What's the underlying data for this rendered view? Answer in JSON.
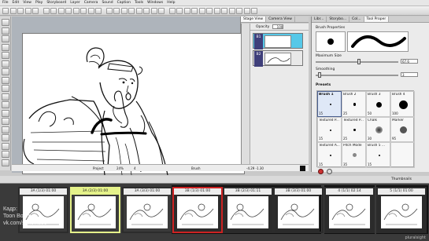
{
  "menu": [
    "File",
    "Edit",
    "View",
    "Play",
    "Storyboard",
    "Layer",
    "Camera",
    "Sound",
    "Caption",
    "Tools",
    "Windows",
    "Help"
  ],
  "stage_tabs": [
    "Stage View",
    "Camera View"
  ],
  "layers": {
    "opacity_label": "Opacity",
    "opacity_value": "100",
    "rows": [
      "B1",
      "B2"
    ]
  },
  "right_tabs": [
    "Libr...",
    "Storybo...",
    "Col...",
    "Tool Proper"
  ],
  "brush": {
    "properties_label": "Brush Properties",
    "max_size_label": "Maximum Size",
    "max_size_value": "67.6",
    "smoothing_label": "Smoothing",
    "smoothing_value": "3",
    "presets_label": "Presets",
    "presets": [
      {
        "name": "Brush 1",
        "value": "15"
      },
      {
        "name": "Brush 2",
        "value": "25"
      },
      {
        "name": "Brush 3",
        "value": "50"
      },
      {
        "name": "Brush 4",
        "value": "100"
      },
      {
        "name": "Textured P...",
        "value": "15"
      },
      {
        "name": "Textured P...",
        "value": "25"
      },
      {
        "name": "Chalk",
        "value": "30"
      },
      {
        "name": "Marker",
        "value": "95"
      },
      {
        "name": "Textured A...",
        "value": "15"
      },
      {
        "name": "Pitch Mode",
        "value": "35"
      },
      {
        "name": "Brush 5 ...",
        "value": "15"
      },
      {
        "name": "",
        "value": ""
      }
    ]
  },
  "status": {
    "project": "Project",
    "zoom": "24%",
    "frame": "4",
    "tool": "Brush",
    "coords": "-4.29 -1.30"
  },
  "thumbnails": {
    "title": "Thumbnails",
    "panels": [
      "3A (1/3) 01:00",
      "3A (2/3) 01:00",
      "3A (3/3) 01:00",
      "3B (1/3) 01:00",
      "3B (2/3) 01:11",
      "3B (3/3) 01:00",
      "4 (1/1) 02:14",
      "5 (1/1) 01:00"
    ]
  },
  "watermark": {
    "line1": "Кадр:",
    "line2": "Toon Boom",
    "line3": "vk.com/sensvideo"
  },
  "corner_text": "pluralsight",
  "colors": {
    "accent_selected": "#cc2222",
    "highlight": "#e5f28a",
    "layer_blue": "#56c8e8"
  }
}
